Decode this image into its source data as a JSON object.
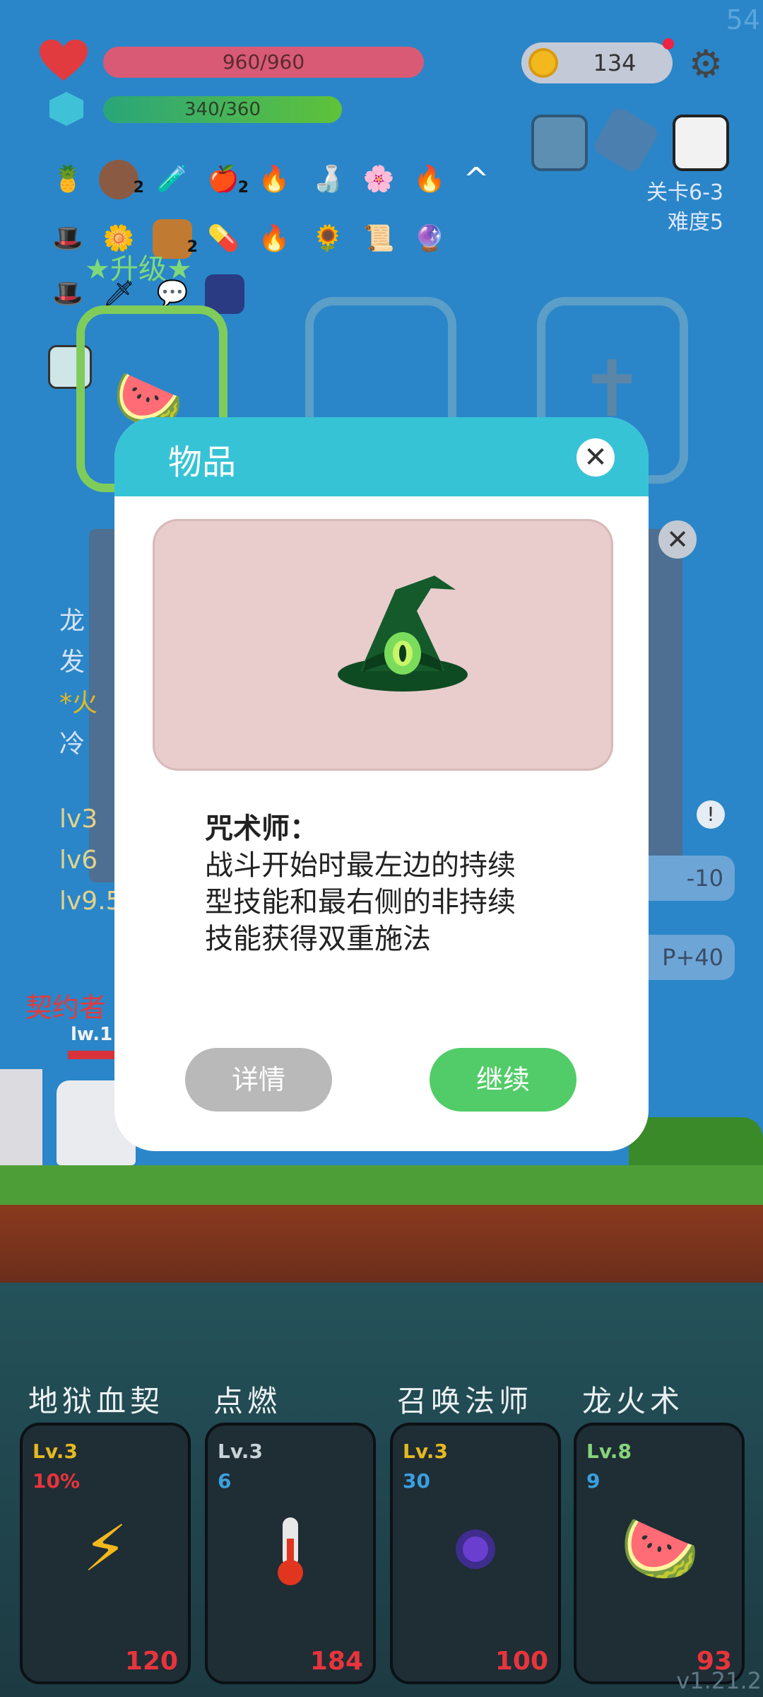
{
  "hud": {
    "fps": "54",
    "hp_text": "960/960",
    "mp_text": "340/360",
    "coins": "134",
    "stage": "关卡6-3",
    "difficulty": "难度5"
  },
  "items_badges": [
    "2",
    "2",
    "2"
  ],
  "levelup_text": "★升级★",
  "background": {
    "contract_text": "契约者",
    "level_text": "lw.1",
    "lines": [
      "龙",
      "发",
      "*火",
      "冷",
      "lv3",
      "lv6",
      "lv9.5"
    ],
    "side_button_1": "-10",
    "side_button_2": "P+40"
  },
  "modal": {
    "title": "物品",
    "item_name": "咒术师：",
    "item_desc_1": "战斗开始时最左边的持续",
    "item_desc_2": "型技能和最右侧的非持续",
    "item_desc_3": "技能获得双重施法",
    "detail_label": "详情",
    "continue_label": "继续"
  },
  "skills": [
    {
      "name": "地狱血契",
      "level": "Lv.3",
      "value": "10%",
      "cost": "120",
      "level_color": "#e5b91f",
      "value_color": "#e8343c"
    },
    {
      "name": "点燃",
      "level": "Lv.3",
      "value": "6",
      "cost": "184",
      "level_color": "#c9d3d8",
      "value_color": "#3aa0df"
    },
    {
      "name": "召唤法师",
      "level": "Lv.3",
      "value": "30",
      "cost": "100",
      "level_color": "#e5b91f",
      "value_color": "#3aa0df"
    },
    {
      "name": "龙火术",
      "level": "Lv.8",
      "value": "9",
      "cost": "93",
      "level_color": "#86d47a",
      "value_color": "#3aa0df"
    }
  ],
  "version": "v1.21.2"
}
